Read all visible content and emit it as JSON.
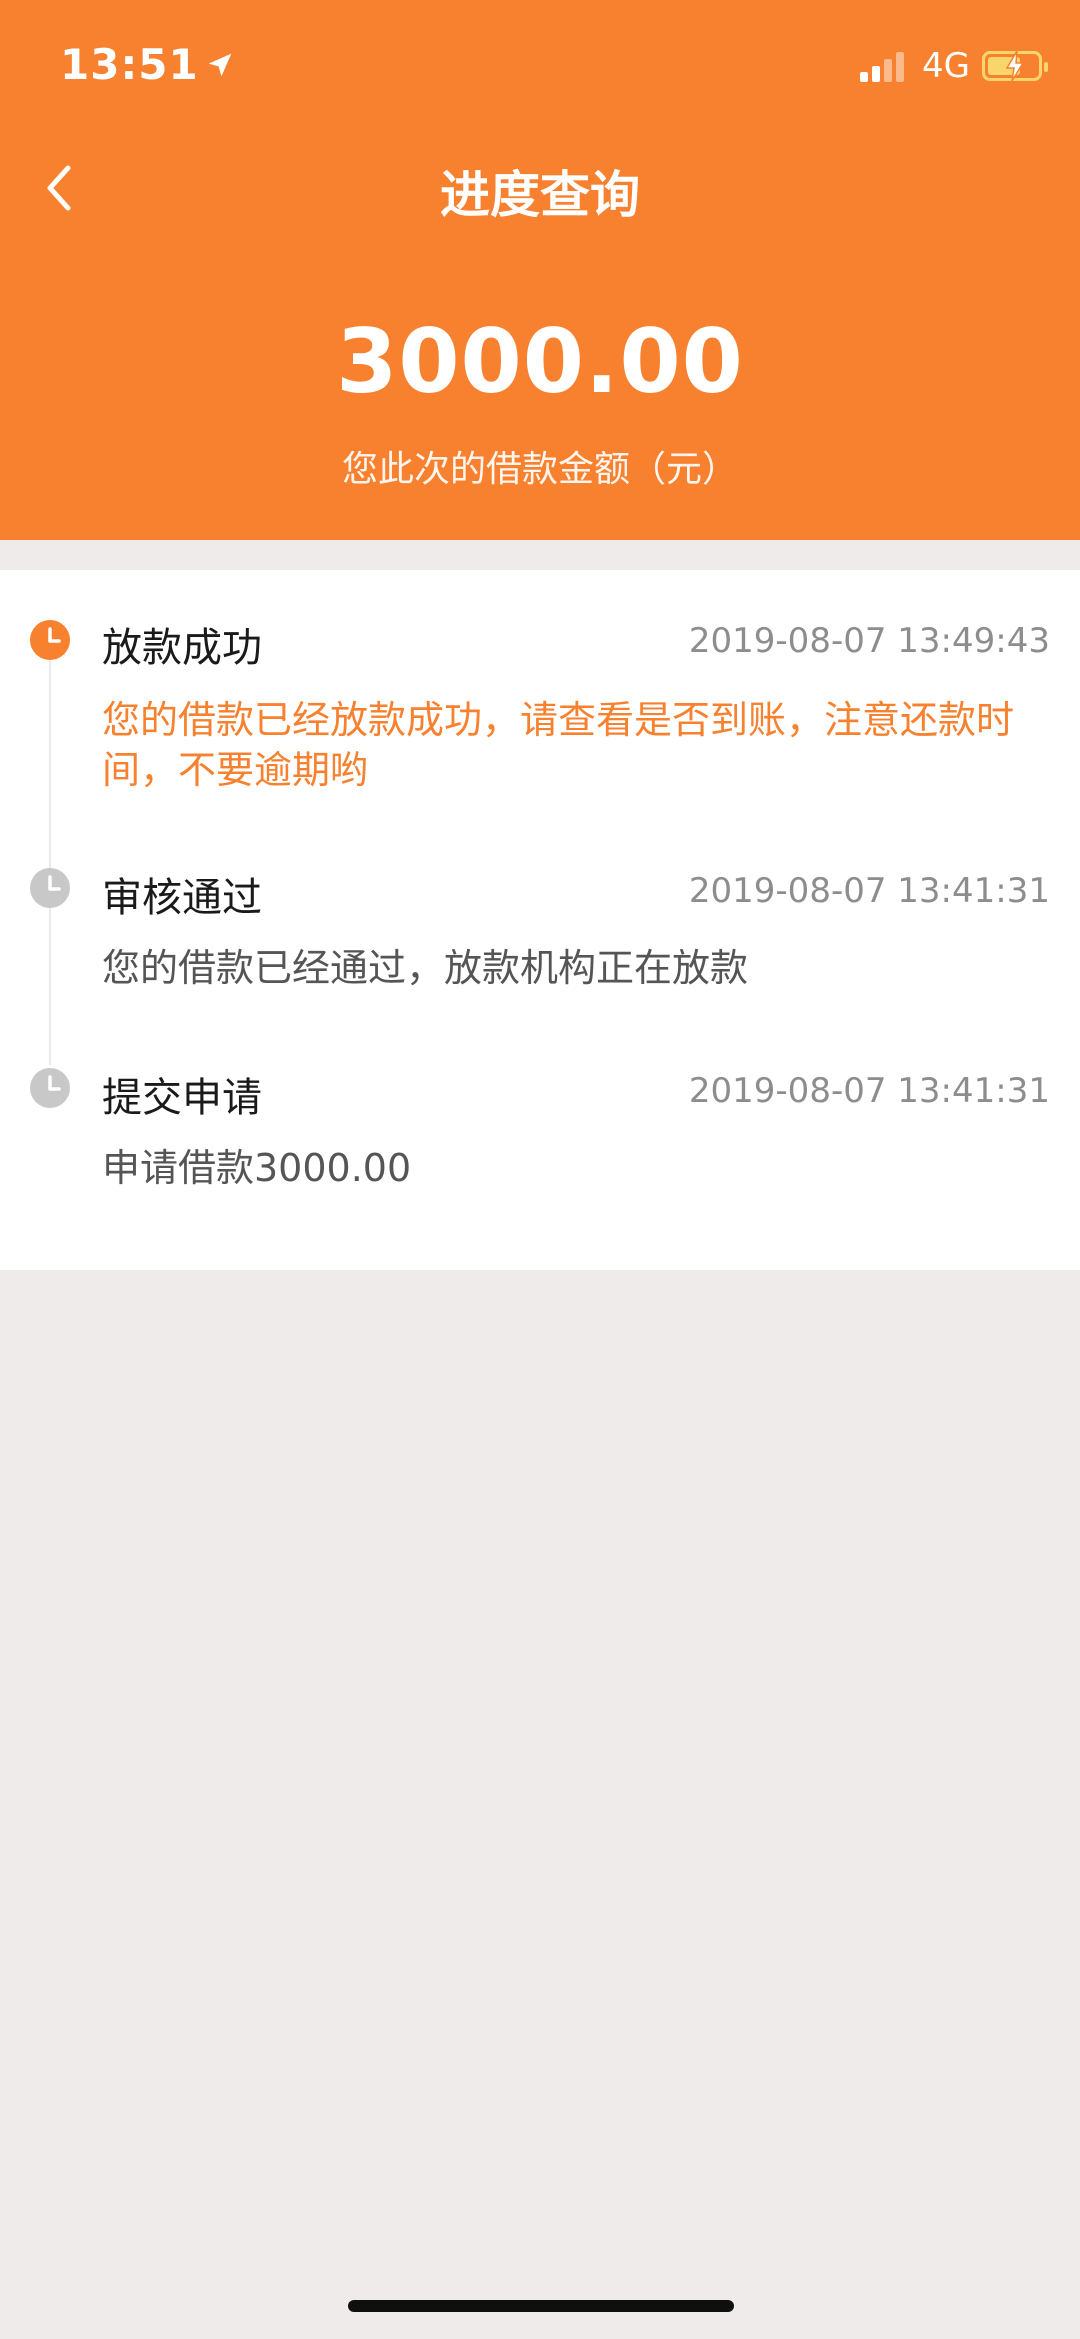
{
  "status_bar": {
    "time": "13:51",
    "network": "4G"
  },
  "header": {
    "title": "进度查询",
    "amount": "3000.00",
    "amount_label": "您此次的借款金额（元）"
  },
  "timeline": [
    {
      "title": "放款成功",
      "time": "2019-08-07 13:49:43",
      "desc": "您的借款已经放款成功，请查看是否到账，注意还款时间，不要逾期哟",
      "active": true
    },
    {
      "title": "审核通过",
      "time": "2019-08-07 13:41:31",
      "desc": "您的借款已经通过，放款机构正在放款",
      "active": false
    },
    {
      "title": "提交申请",
      "time": "2019-08-07 13:41:31",
      "desc": "申请借款3000.00",
      "active": false
    }
  ],
  "icons": {
    "back": "chevron-left-icon",
    "location": "location-arrow-icon",
    "clock": "clock-icon"
  },
  "colors": {
    "accent": "#f7812f",
    "background": "#efebea",
    "inactive_dot": "#c8c8c8"
  }
}
